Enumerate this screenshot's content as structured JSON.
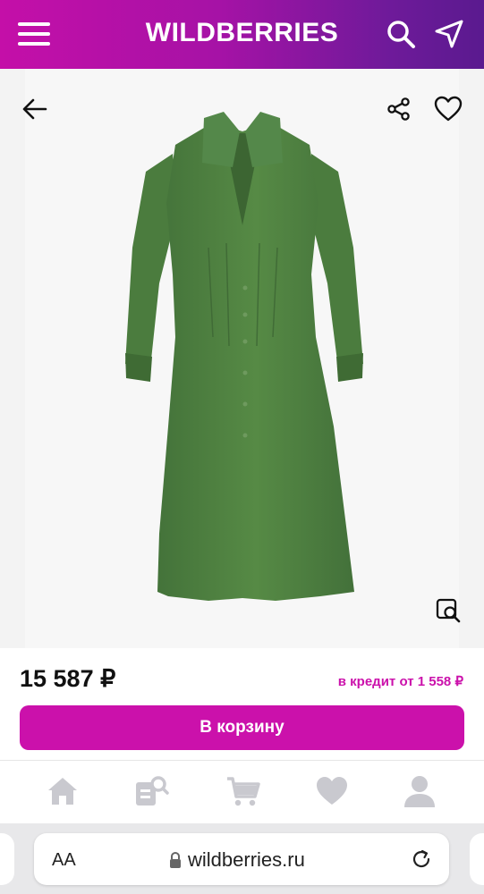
{
  "header": {
    "brand": "WILDBERRIES",
    "gradient_start": "#c40fa8",
    "gradient_end": "#5a1a8f"
  },
  "gallery": {
    "back_icon": "arrow-left-icon",
    "share_icon": "share-icon",
    "favorite_icon": "heart-outline-icon",
    "zoom_icon": "image-search-icon",
    "product_color": "#4f7f3f"
  },
  "price": {
    "value": "15 587 ₽",
    "credit": "в кредит от 1 558 ₽",
    "accent": "#cb11ab"
  },
  "cart": {
    "label": "В корзину"
  },
  "bottom_nav": [
    {
      "icon": "home-icon"
    },
    {
      "icon": "catalog-search-icon"
    },
    {
      "icon": "cart-icon"
    },
    {
      "icon": "heart-icon"
    },
    {
      "icon": "profile-icon"
    }
  ],
  "browser": {
    "text_size_label": "AA",
    "url": "wildberries.ru"
  }
}
